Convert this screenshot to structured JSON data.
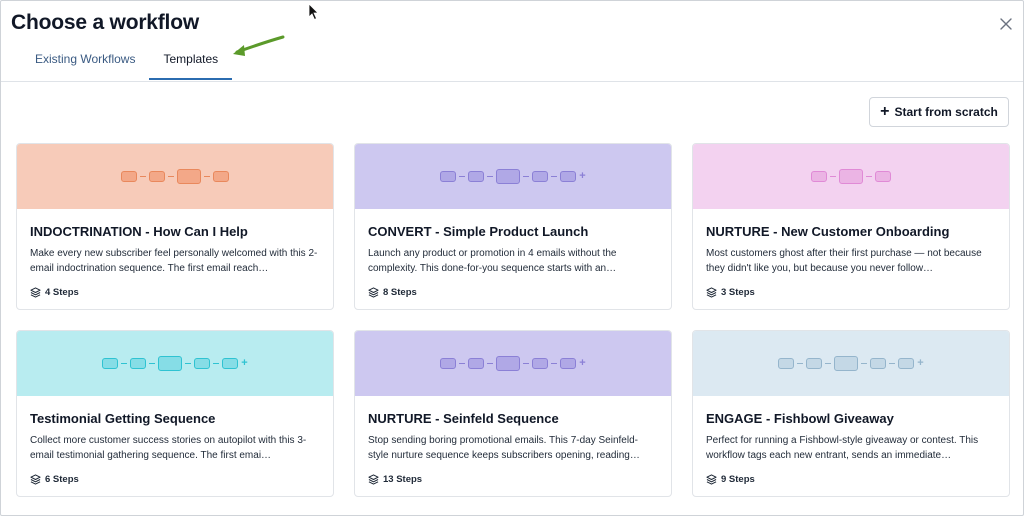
{
  "dialog": {
    "title": "Choose a workflow"
  },
  "tabs": [
    {
      "label": "Existing Workflows",
      "active": false
    },
    {
      "label": "Templates",
      "active": true
    }
  ],
  "start_button": {
    "label": "Start from scratch"
  },
  "colors": {
    "accent": "#2b6cb0",
    "arrow": "#5b9a2a"
  },
  "cards": [
    {
      "title": "INDOCTRINATION - How Can I Help",
      "description": "Make every new subscriber feel personally welcomed with this 2-email indoctrination sequence. The first email reach…",
      "steps": "4 Steps",
      "banner": "#f7cbb9",
      "stroke": "#e9885c",
      "fill": "#f3a888"
    },
    {
      "title": "CONVERT - Simple Product Launch",
      "description": "Launch any product or promotion in 4 emails without the complexity. This done-for-you sequence starts with an…",
      "steps": "8 Steps",
      "banner": "#cdc8f0",
      "stroke": "#8b80d6",
      "fill": "#b0a8e6"
    },
    {
      "title": "NURTURE - New Customer Onboarding",
      "description": "Most customers ghost after their first purchase — not because they didn't like you, but because you never follow…",
      "steps": "3 Steps",
      "banner": "#f3d2f0",
      "stroke": "#e08ad6",
      "fill": "#ebb4e4"
    },
    {
      "title": "Testimonial Getting Sequence",
      "description": "Collect more customer success stories on autopilot with this 3-email testimonial gathering sequence. The first emai…",
      "steps": "6 Steps",
      "banner": "#b8ecf0",
      "stroke": "#2fc3d2",
      "fill": "#86dde6"
    },
    {
      "title": "NURTURE - Seinfeld Sequence",
      "description": "Stop sending boring promotional emails. This 7-day Seinfeld-style nurture sequence keeps subscribers opening, reading…",
      "steps": "13 Steps",
      "banner": "#cdc8f0",
      "stroke": "#8b80d6",
      "fill": "#b0a8e6"
    },
    {
      "title": "ENGAGE - Fishbowl Giveaway",
      "description": "Perfect for running a Fishbowl-style giveaway or contest. This workflow tags each new entrant, sends an immediate…",
      "steps": "9 Steps",
      "banner": "#dce9f2",
      "stroke": "#95b5cc",
      "fill": "#c4d8e6"
    }
  ]
}
